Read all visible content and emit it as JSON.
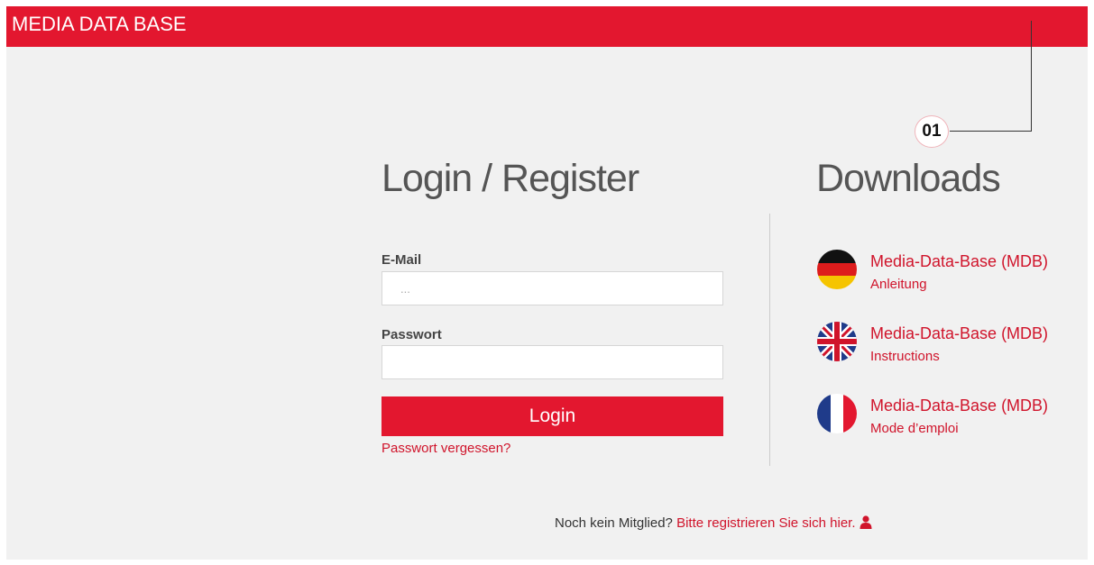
{
  "header": {
    "title": "MEDIA DATA BASE",
    "color": "#e3172f"
  },
  "callout": {
    "label": "01"
  },
  "login": {
    "heading": "Login / Register",
    "email_label": "E-Mail",
    "email_placeholder": "...",
    "email_value": "",
    "password_label": "Passwort",
    "password_value": "",
    "login_button": "Login",
    "forgot_link": "Passwort vergessen?"
  },
  "downloads": {
    "heading": "Downloads",
    "items": [
      {
        "flag": "germany-flag-icon",
        "title": "Media-Data-Base (MDB)",
        "subtitle": "Anleitung"
      },
      {
        "flag": "uk-flag-icon",
        "title": "Media-Data-Base (MDB)",
        "subtitle": "Instructions"
      },
      {
        "flag": "france-flag-icon",
        "title": "Media-Data-Base (MDB)",
        "subtitle": "Mode d’emploi"
      }
    ]
  },
  "footer": {
    "prompt": "Noch kein Mitglied?",
    "register_link": "Bitte registrieren Sie sich hier.",
    "icon": "user-icon"
  },
  "colors": {
    "accent": "#e3172f",
    "link": "#d0142b",
    "background": "#f1f1f1",
    "heading": "#555555"
  }
}
